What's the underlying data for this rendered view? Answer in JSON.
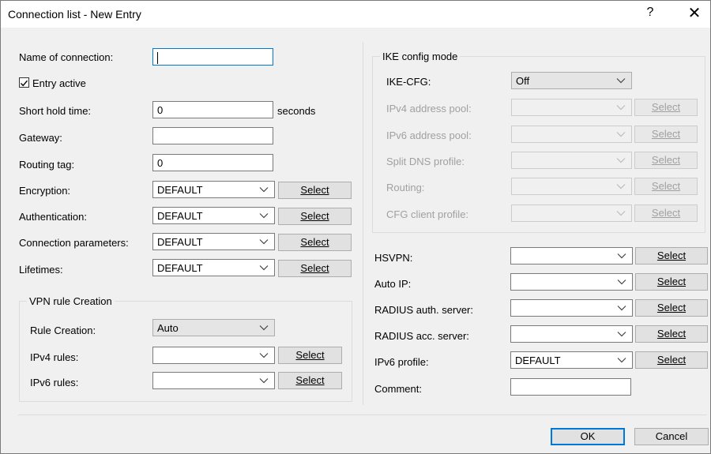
{
  "window": {
    "title": "Connection list - New Entry",
    "help": "?",
    "close": "✕"
  },
  "left": {
    "name_label": "Name of connection:",
    "name_value": "",
    "entry_active_label": "Entry active",
    "entry_active_checked": true,
    "short_hold_label": "Short hold time:",
    "short_hold_value": "0",
    "short_hold_unit": "seconds",
    "gateway_label": "Gateway:",
    "gateway_value": "",
    "routing_tag_label": "Routing tag:",
    "routing_tag_value": "0",
    "encryption_label": "Encryption:",
    "encryption_value": "DEFAULT",
    "authentication_label": "Authentication:",
    "authentication_value": "DEFAULT",
    "conn_params_label": "Connection parameters:",
    "conn_params_value": "DEFAULT",
    "lifetimes_label": "Lifetimes:",
    "lifetimes_value": "DEFAULT"
  },
  "vpn_rule": {
    "title": "VPN rule Creation",
    "rule_creation_label": "Rule Creation:",
    "rule_creation_value": "Auto",
    "ipv4_label": "IPv4 rules:",
    "ipv4_value": "",
    "ipv6_label": "IPv6 rules:",
    "ipv6_value": ""
  },
  "ike": {
    "title": "IKE config mode",
    "cfg_label": "IKE-CFG:",
    "cfg_value": "Off",
    "ipv4_pool_label": "IPv4 address pool:",
    "ipv6_pool_label": "IPv6 address pool:",
    "split_dns_label": "Split DNS profile:",
    "routing_label": "Routing:",
    "client_profile_label": "CFG client profile:"
  },
  "right": {
    "hsvpn_label": "HSVPN:",
    "hsvpn_value": "",
    "auto_ip_label": "Auto IP:",
    "auto_ip_value": "",
    "radius_auth_label": "RADIUS auth. server:",
    "radius_auth_value": "",
    "radius_acc_label": "RADIUS acc. server:",
    "radius_acc_value": "",
    "ipv6_profile_label": "IPv6 profile:",
    "ipv6_profile_value": "DEFAULT",
    "comment_label": "Comment:",
    "comment_value": ""
  },
  "buttons": {
    "select": "Select",
    "ok": "OK",
    "cancel": "Cancel"
  }
}
